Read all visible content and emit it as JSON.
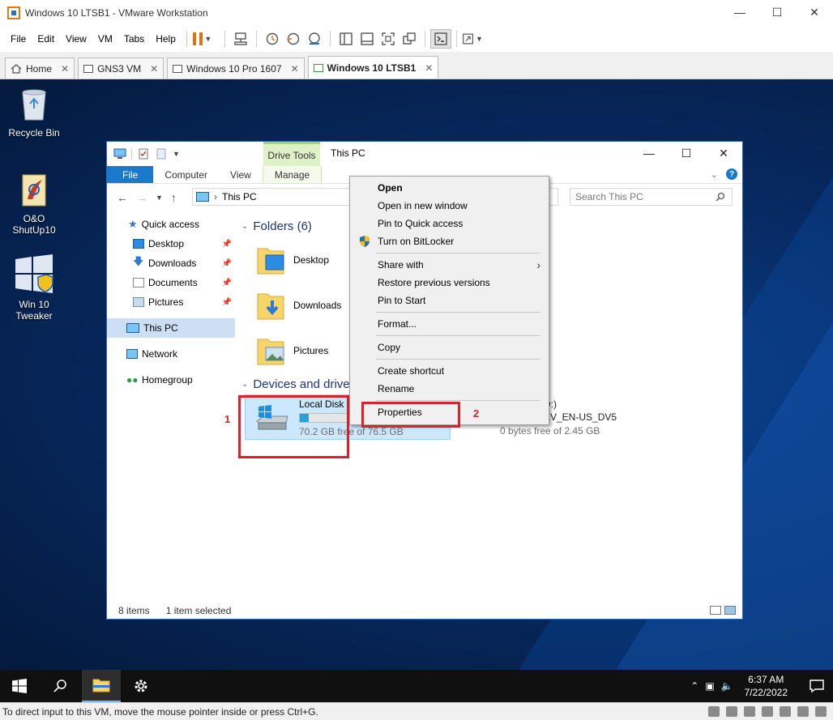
{
  "vm_window": {
    "title": "Windows 10 LTSB1 - VMware Workstation",
    "menus": [
      "File",
      "Edit",
      "View",
      "VM",
      "Tabs",
      "Help"
    ],
    "tabs": [
      {
        "label": "Home",
        "active": false
      },
      {
        "label": "GNS3 VM",
        "active": false
      },
      {
        "label": "Windows 10 Pro 1607",
        "active": false
      },
      {
        "label": "Windows 10 LTSB1",
        "active": true
      }
    ],
    "status_text": "To direct input to this VM, move the mouse pointer inside or press Ctrl+G."
  },
  "desktop": {
    "icons": [
      {
        "label": "Recycle Bin",
        "icon": "recycle-bin-icon"
      },
      {
        "label": "O&O ShutUp10",
        "icon": "oo-shutup-icon"
      },
      {
        "label": "Win 10 Tweaker",
        "icon": "win10-tweaker-icon"
      }
    ]
  },
  "explorer": {
    "title": "This PC",
    "contextual_tab": "Drive Tools",
    "ribbon_tabs": [
      "File",
      "Computer",
      "View",
      "Manage"
    ],
    "address": "This PC",
    "search_placeholder": "Search This PC",
    "nav": {
      "quick_access": "Quick access",
      "pinned": [
        "Desktop",
        "Downloads",
        "Documents",
        "Pictures"
      ],
      "this_pc": "This PC",
      "network": "Network",
      "homegroup": "Homegroup"
    },
    "folders_header": "Folders (6)",
    "folders": [
      "Desktop",
      "Downloads",
      "Pictures"
    ],
    "devices_header": "Devices and drives",
    "drive": {
      "name": "Local Disk (C:)",
      "free_text": "70.2 GB free of 76.5 GB",
      "used_fraction": 0.08
    },
    "dvd": {
      "name_fragment": "D:)",
      "label_fragment": "EV_EN-US_DV5",
      "free_text": "0 bytes free of 2.45 GB"
    },
    "status": {
      "items": "8 items",
      "selected": "1 item selected"
    }
  },
  "context_menu": {
    "groups": [
      [
        {
          "label": "Open",
          "bold": true
        },
        {
          "label": "Open in new window"
        },
        {
          "label": "Pin to Quick access"
        },
        {
          "label": "Turn on BitLocker",
          "icon": "shield-icon"
        }
      ],
      [
        {
          "label": "Share with",
          "submenu": true
        },
        {
          "label": "Restore previous versions"
        },
        {
          "label": "Pin to Start"
        }
      ],
      [
        {
          "label": "Format..."
        }
      ],
      [
        {
          "label": "Copy"
        }
      ],
      [
        {
          "label": "Create shortcut"
        },
        {
          "label": "Rename"
        }
      ],
      [
        {
          "label": "Properties"
        }
      ]
    ]
  },
  "annotations": {
    "step1": "1",
    "step2": "2",
    "color": "#d9232a"
  },
  "taskbar": {
    "time": "6:37 AM",
    "date": "7/22/2022"
  },
  "colors": {
    "accent": "#1979ca",
    "pause": "#e8700f",
    "selection": "#cce8ff"
  }
}
